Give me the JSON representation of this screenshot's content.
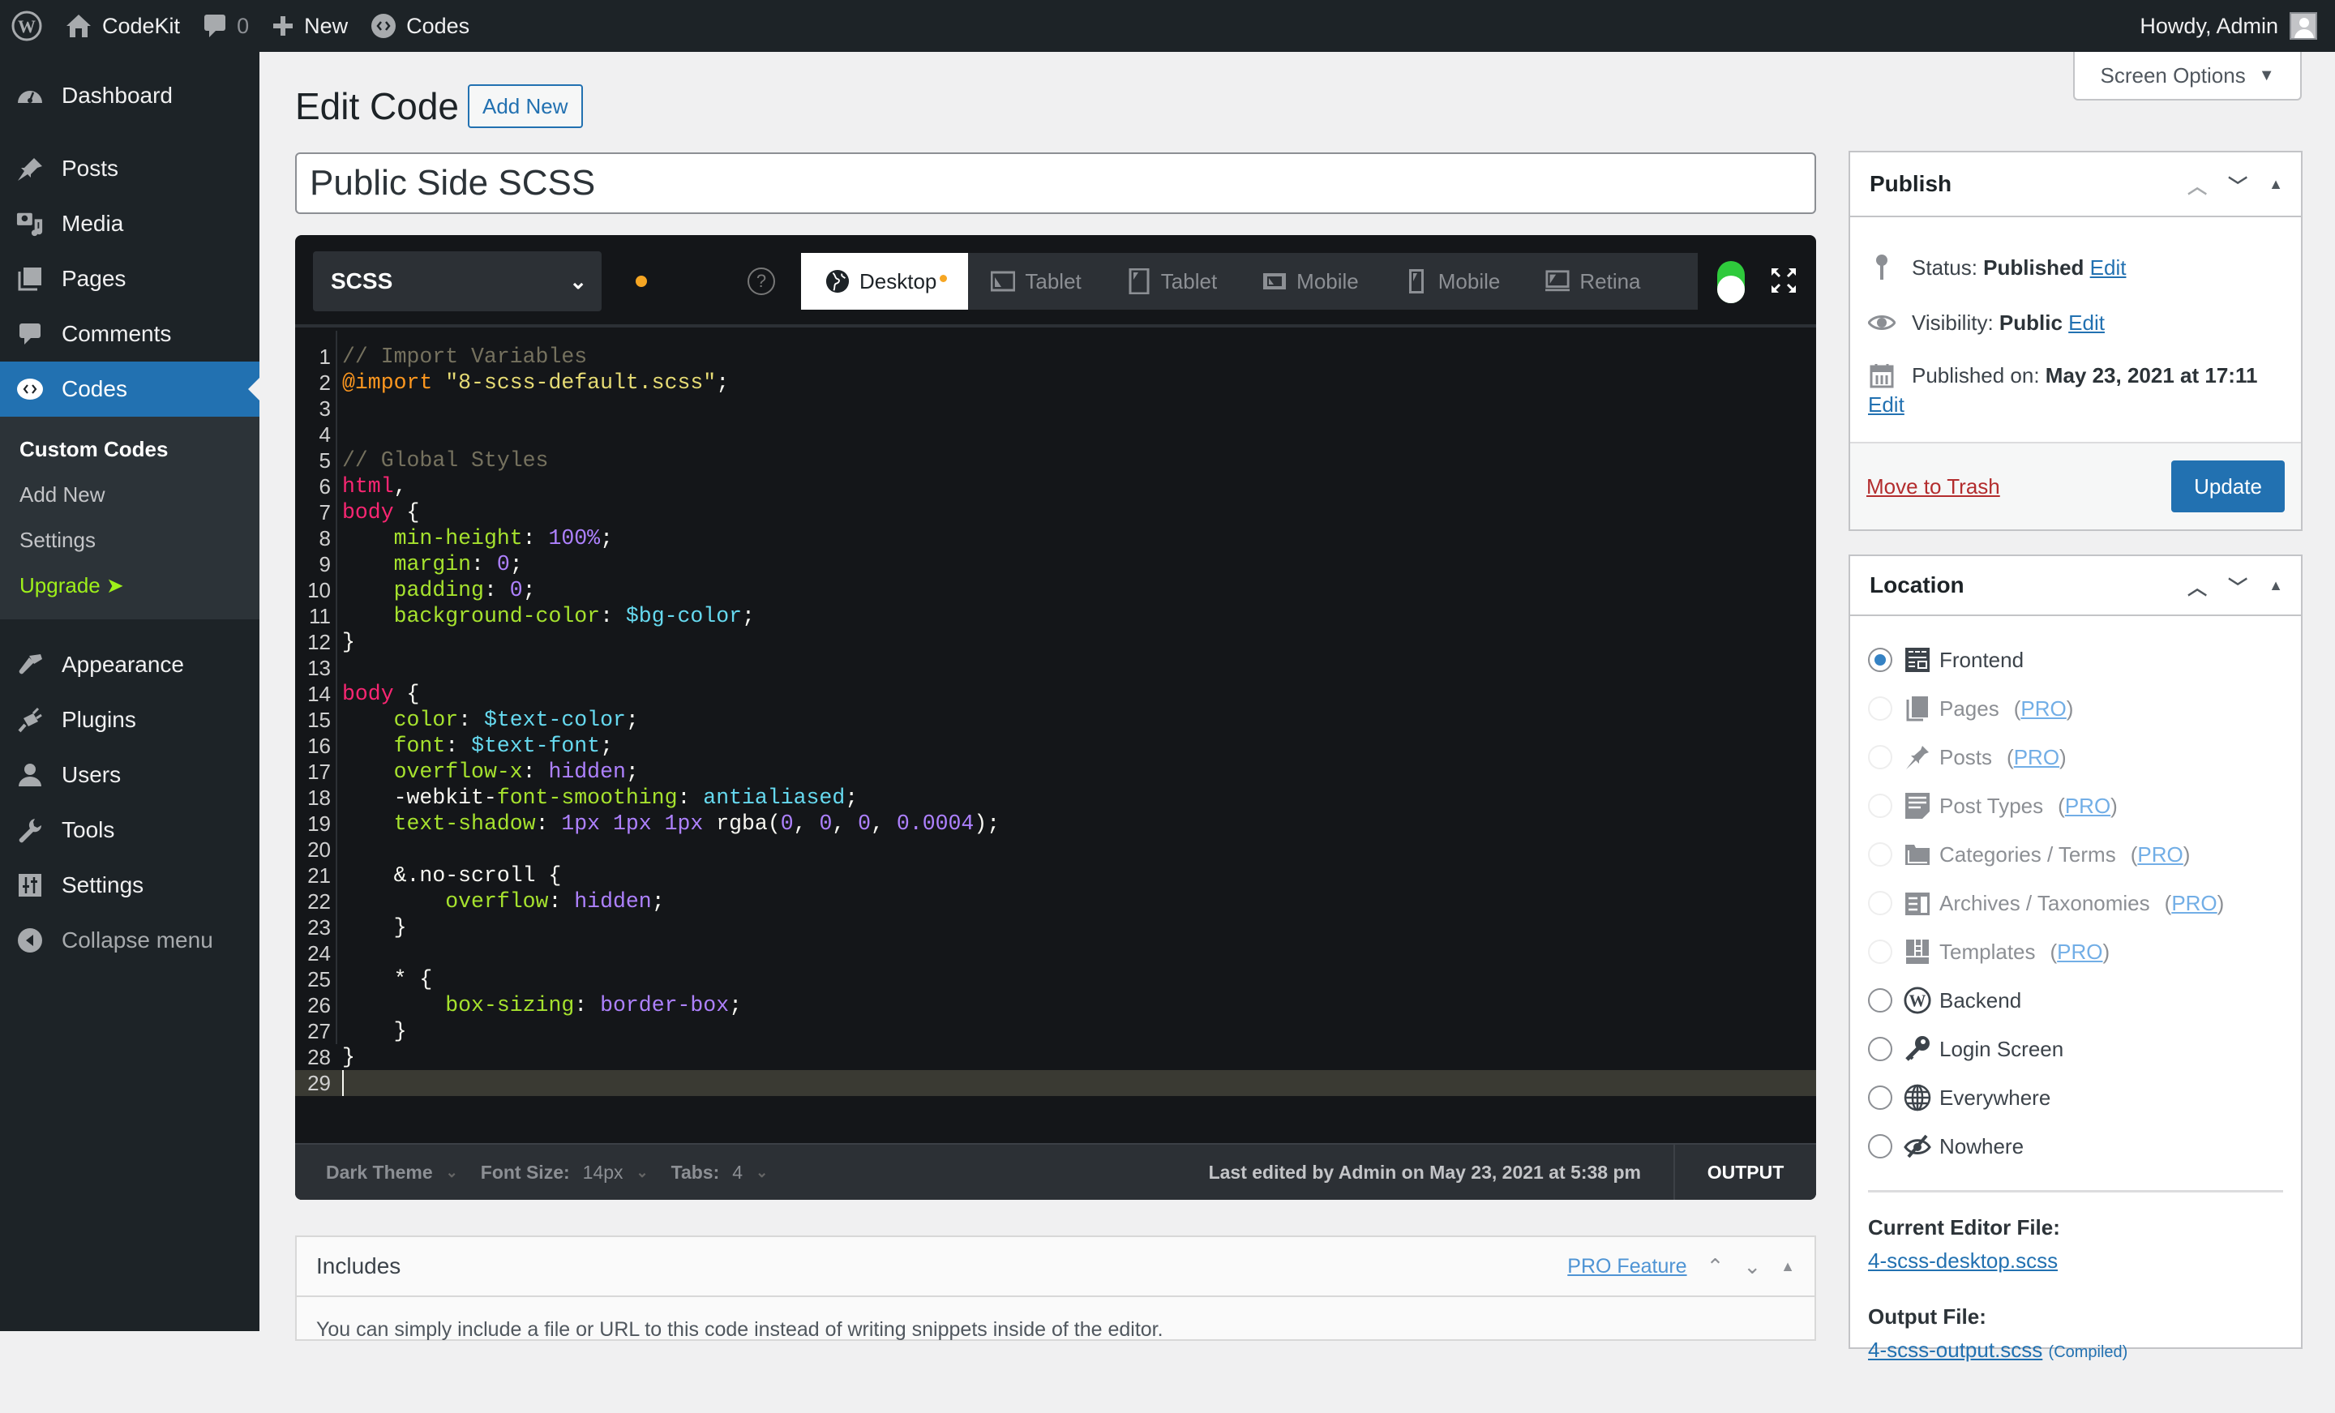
{
  "adminbar": {
    "site_name": "CodeKit",
    "comments_count": "0",
    "new_label": "New",
    "codes_label": "Codes",
    "greeting": "Howdy, Admin"
  },
  "sidebar": {
    "items": [
      {
        "label": "Dashboard",
        "icon": "dashboard-icon"
      },
      {
        "label": "Posts",
        "icon": "pin-icon"
      },
      {
        "label": "Media",
        "icon": "media-icon"
      },
      {
        "label": "Pages",
        "icon": "pages-icon"
      },
      {
        "label": "Comments",
        "icon": "comment-icon"
      },
      {
        "label": "Codes",
        "icon": "code-icon",
        "active": true
      }
    ],
    "submenu": [
      {
        "label": "Custom Codes",
        "current": true
      },
      {
        "label": "Add New"
      },
      {
        "label": "Settings"
      },
      {
        "label": "Upgrade ➤",
        "accent": "#9ef01a"
      }
    ],
    "items_after": [
      {
        "label": "Appearance",
        "icon": "brush-icon"
      },
      {
        "label": "Plugins",
        "icon": "plug-icon"
      },
      {
        "label": "Users",
        "icon": "user-icon"
      },
      {
        "label": "Tools",
        "icon": "wrench-icon"
      },
      {
        "label": "Settings",
        "icon": "settings-icon"
      }
    ],
    "collapse_label": "Collapse menu"
  },
  "header": {
    "title": "Edit Code",
    "add_new": "Add New",
    "screen_options": "Screen Options"
  },
  "post_title": "Public Side SCSS",
  "editor": {
    "language": "SCSS",
    "help": "?",
    "devices": [
      {
        "label": "Desktop",
        "icon": "globe-icon",
        "active": true,
        "modified": true
      },
      {
        "label": "Tablet",
        "icon": "tablet-landscape-icon"
      },
      {
        "label": "Tablet",
        "icon": "tablet-portrait-icon"
      },
      {
        "label": "Mobile",
        "icon": "mobile-landscape-icon"
      },
      {
        "label": "Mobile",
        "icon": "mobile-portrait-icon"
      },
      {
        "label": "Retina",
        "icon": "retina-icon"
      }
    ],
    "status_enabled": true,
    "lines": [
      [
        [
          "c-com",
          "// Import Variables"
        ]
      ],
      [
        [
          "c-at",
          "@import"
        ],
        [
          "c-pl",
          " "
        ],
        [
          "c-str",
          "\"8-scss-default.scss\""
        ],
        [
          "c-pl",
          ";"
        ]
      ],
      [],
      [],
      [
        [
          "c-com",
          "// Global Styles"
        ]
      ],
      [
        [
          "c-tag",
          "html"
        ],
        [
          "c-pl",
          ","
        ]
      ],
      [
        [
          "c-tag",
          "body"
        ],
        [
          "c-pl",
          " {"
        ]
      ],
      [
        [
          "c-pl",
          "    "
        ],
        [
          "c-prop",
          "min-height"
        ],
        [
          "c-pl",
          ": "
        ],
        [
          "c-num",
          "100%"
        ],
        [
          "c-pl",
          ";"
        ]
      ],
      [
        [
          "c-pl",
          "    "
        ],
        [
          "c-prop",
          "margin"
        ],
        [
          "c-pl",
          ": "
        ],
        [
          "c-num",
          "0"
        ],
        [
          "c-pl",
          ";"
        ]
      ],
      [
        [
          "c-pl",
          "    "
        ],
        [
          "c-prop",
          "padding"
        ],
        [
          "c-pl",
          ": "
        ],
        [
          "c-num",
          "0"
        ],
        [
          "c-pl",
          ";"
        ]
      ],
      [
        [
          "c-pl",
          "    "
        ],
        [
          "c-prop",
          "background-color"
        ],
        [
          "c-pl",
          ": "
        ],
        [
          "c-var",
          "$bg-color"
        ],
        [
          "c-pl",
          ";"
        ]
      ],
      [
        [
          "c-pl",
          "}"
        ]
      ],
      [],
      [
        [
          "c-tag",
          "body"
        ],
        [
          "c-pl",
          " {"
        ]
      ],
      [
        [
          "c-pl",
          "    "
        ],
        [
          "c-prop",
          "color"
        ],
        [
          "c-pl",
          ": "
        ],
        [
          "c-var",
          "$text-color"
        ],
        [
          "c-pl",
          ";"
        ]
      ],
      [
        [
          "c-pl",
          "    "
        ],
        [
          "c-prop",
          "font"
        ],
        [
          "c-pl",
          ": "
        ],
        [
          "c-var",
          "$text-font"
        ],
        [
          "c-pl",
          ";"
        ]
      ],
      [
        [
          "c-pl",
          "    "
        ],
        [
          "c-prop",
          "overflow-x"
        ],
        [
          "c-pl",
          ": "
        ],
        [
          "c-num",
          "hidden"
        ],
        [
          "c-pl",
          ";"
        ]
      ],
      [
        [
          "c-pl",
          "    -webkit-"
        ],
        [
          "c-prop",
          "font-smoothing"
        ],
        [
          "c-pl",
          ": "
        ],
        [
          "c-var",
          "antialiased"
        ],
        [
          "c-pl",
          ";"
        ]
      ],
      [
        [
          "c-pl",
          "    "
        ],
        [
          "c-prop",
          "text-shadow"
        ],
        [
          "c-pl",
          ": "
        ],
        [
          "c-num",
          "1px 1px 1px"
        ],
        [
          "c-pl",
          " rgba("
        ],
        [
          "c-num",
          "0"
        ],
        [
          "c-pl",
          ", "
        ],
        [
          "c-num",
          "0"
        ],
        [
          "c-pl",
          ", "
        ],
        [
          "c-num",
          "0"
        ],
        [
          "c-pl",
          ", "
        ],
        [
          "c-num",
          "0.0004"
        ],
        [
          "c-pl",
          ");"
        ]
      ],
      [],
      [
        [
          "c-pl",
          "    &.no-scroll {"
        ]
      ],
      [
        [
          "c-pl",
          "        "
        ],
        [
          "c-prop",
          "overflow"
        ],
        [
          "c-pl",
          ": "
        ],
        [
          "c-num",
          "hidden"
        ],
        [
          "c-pl",
          ";"
        ]
      ],
      [
        [
          "c-pl",
          "    }"
        ]
      ],
      [],
      [
        [
          "c-pl",
          "    * {"
        ]
      ],
      [
        [
          "c-pl",
          "        "
        ],
        [
          "c-prop",
          "box-sizing"
        ],
        [
          "c-pl",
          ": "
        ],
        [
          "c-num",
          "border-box"
        ],
        [
          "c-pl",
          ";"
        ]
      ],
      [
        [
          "c-pl",
          "    }"
        ]
      ],
      [
        [
          "c-pl",
          "}"
        ]
      ],
      []
    ],
    "cursor_line": 29,
    "footer": {
      "theme": "Dark Theme",
      "font_size_label": "Font Size:",
      "font_size": "14px",
      "tabs_label": "Tabs:",
      "tabs": "4",
      "last_edited": "Last edited by Admin on May 23, 2021 at 5:38 pm",
      "output": "OUTPUT"
    }
  },
  "includes": {
    "title": "Includes",
    "pro_link": "PRO Feature",
    "description": "You can simply include a file or URL to this code instead of writing snippets inside of the editor."
  },
  "publish": {
    "title": "Publish",
    "status_label": "Status:",
    "status_value": "Published",
    "visibility_label": "Visibility:",
    "visibility_value": "Public",
    "published_label": "Published on:",
    "published_value": "May 23, 2021 at 17:11",
    "edit": "Edit",
    "trash": "Move to Trash",
    "update": "Update"
  },
  "location": {
    "title": "Location",
    "options": [
      {
        "label": "Frontend",
        "icon": "frontend-icon",
        "checked": true
      },
      {
        "label": "Pages",
        "icon": "pages-icon",
        "pro": "PRO",
        "disabled": true
      },
      {
        "label": "Posts",
        "icon": "pin-icon",
        "pro": "PRO",
        "disabled": true
      },
      {
        "label": "Post Types",
        "icon": "post-types-icon",
        "pro": "PRO",
        "disabled": true
      },
      {
        "label": "Categories / Terms",
        "icon": "folder-icon",
        "pro": "PRO",
        "disabled": true
      },
      {
        "label": "Archives / Taxonomies",
        "icon": "archive-icon",
        "pro": "PRO",
        "disabled": true
      },
      {
        "label": "Templates",
        "icon": "templates-icon",
        "pro": "PRO",
        "disabled": true
      },
      {
        "label": "Backend",
        "icon": "wordpress-icon"
      },
      {
        "label": "Login Screen",
        "icon": "key-icon"
      },
      {
        "label": "Everywhere",
        "icon": "globe-icon"
      },
      {
        "label": "Nowhere",
        "icon": "hidden-icon"
      }
    ],
    "current_file_label": "Current Editor File:",
    "current_file": "4-scss-desktop.scss",
    "output_file_label": "Output File:",
    "output_file": "4-scss-output.scss",
    "output_note": "(Compiled)"
  }
}
